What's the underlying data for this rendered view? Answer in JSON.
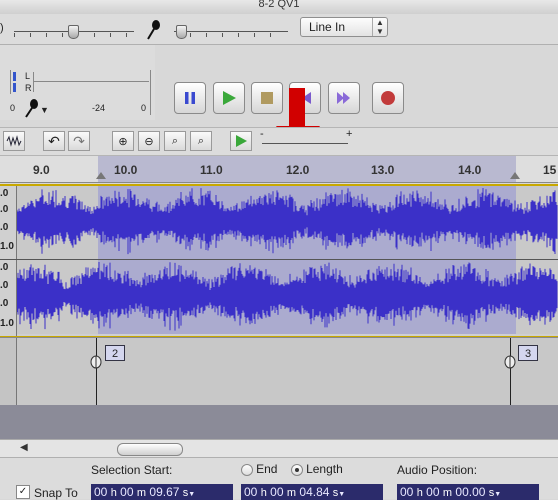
{
  "window": {
    "title": "8-2 QV1"
  },
  "toolbar": {
    "input_device": "Line In",
    "volume_icon": "speaker-icon",
    "mic_icon": "microphone-icon"
  },
  "meter": {
    "left_channel": "L",
    "right_channel": "R",
    "scale_left": "0",
    "scale_mid": "-24",
    "scale_right": "0"
  },
  "transport": {
    "buttons": [
      "pause",
      "play",
      "stop",
      "skip-start",
      "skip-end",
      "record"
    ]
  },
  "edit_toolbar": {
    "play_at_speed_minus": "-",
    "play_at_speed_plus": "+"
  },
  "ruler": {
    "labels": [
      "9.0",
      "10.0",
      "11.0",
      "12.0",
      "13.0",
      "14.0",
      "15"
    ]
  },
  "tracks": [
    {
      "scale": [
        ".0",
        ".0",
        ".0",
        "1.0"
      ]
    },
    {
      "scale": [
        ".0",
        ".0",
        ".0",
        "1.0"
      ]
    }
  ],
  "label_track": {
    "labels": [
      "2",
      "3"
    ]
  },
  "selection_bar": {
    "selection_start_label": "Selection Start:",
    "end_label": "End",
    "length_label": "Length",
    "audio_position_label": "Audio Position:",
    "snap_to_label": "Snap To",
    "selection_start": {
      "h": "00",
      "m": "00",
      "s": "09.67"
    },
    "length": {
      "h": "00",
      "m": "00",
      "s": "04.84"
    },
    "audio_position": {
      "h": "00",
      "m": "00",
      "s": "00.00"
    },
    "unit_h": "h",
    "unit_m": "m",
    "unit_s": "s"
  },
  "colors": {
    "waveform": "#3b30c8",
    "selection_bg": "#ababcf",
    "annotation_arrow": "#cc0000",
    "record": "#c23b3b",
    "play": "#3aa83a"
  }
}
